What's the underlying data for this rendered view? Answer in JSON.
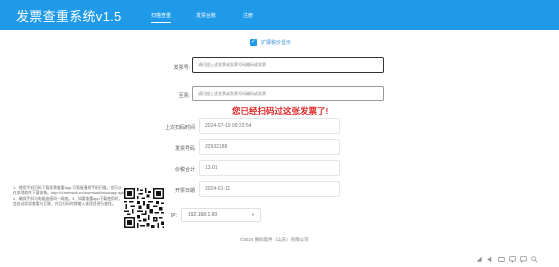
{
  "app": {
    "title": "发票查重系统v1.5"
  },
  "nav": {
    "tabs": [
      "扫描查重",
      "发票台账",
      "注册"
    ]
  },
  "options": {
    "tax_shown_label": "扩展税价显示"
  },
  "form": {
    "invoice_no": {
      "label": "发票号:",
      "placeholder": "请扫描上述发票或发票号码编码或发票"
    },
    "remark": {
      "label": "互票:",
      "placeholder": "请扫描上述发票或发票号码编码或发票"
    }
  },
  "alert": {
    "message": "您已经扫码过这张发票了!"
  },
  "details": [
    {
      "label": "上次扫码时间",
      "value": "2024-07-19 09:23:54"
    },
    {
      "label": "发票号码",
      "value": "22932188"
    },
    {
      "label": "价税合计",
      "value": "13.01"
    },
    {
      "label": "开票日期",
      "value": "2024-01-11"
    }
  ],
  "instructions": {
    "text": "1、使用手机扫码下载发票查重App,可直接通常手机扫描，也可以在本地软件下载安装。http://d.iwehsoft.cn/download/invoicapp.apk 2、确保手机与电脑连接同一网络。3、如要查重app下载使用时，会自动实现查重与互联，并且扫码时就输入该项目进行查找。"
  },
  "ip": {
    "label": "IP:",
    "value": "192.168.1.60"
  },
  "footer": {
    "copyright": "©2024 易码软件（山东）有限公司"
  },
  "colors": {
    "accent": "#1e9ae8",
    "alert": "#e02424"
  },
  "taskbar": {
    "icons": [
      "network-icon",
      "sound-icon",
      "keyboard-icon",
      "display-icon",
      "message-icon",
      "search-icon"
    ]
  }
}
